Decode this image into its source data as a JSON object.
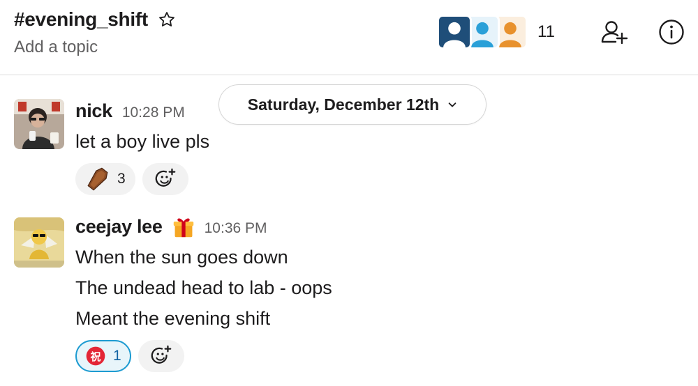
{
  "header": {
    "channel": "#evening_shift",
    "topic": "Add a topic",
    "member_count": "11"
  },
  "date_divider": {
    "label": "Saturday, December 12th"
  },
  "messages": [
    {
      "author": "nick",
      "time": "10:28 PM",
      "lines": [
        "let a boy live pls"
      ],
      "reactions": [
        {
          "emoji": "coffin",
          "count": "3"
        }
      ]
    },
    {
      "author": "ceejay lee",
      "time": "10:36 PM",
      "status_emoji": "gift",
      "lines": [
        "When the sun goes down",
        "The undead head to lab - oops",
        "Meant the evening shift"
      ],
      "reactions": [
        {
          "emoji": "congratulations-kanji",
          "count": "1",
          "active": true
        }
      ]
    }
  ],
  "colors": {
    "accent_blue": "#1d9bd1",
    "member_dark": "#1f4e79",
    "member_blue": "#2aa0d8",
    "member_orange": "#e8912d"
  }
}
